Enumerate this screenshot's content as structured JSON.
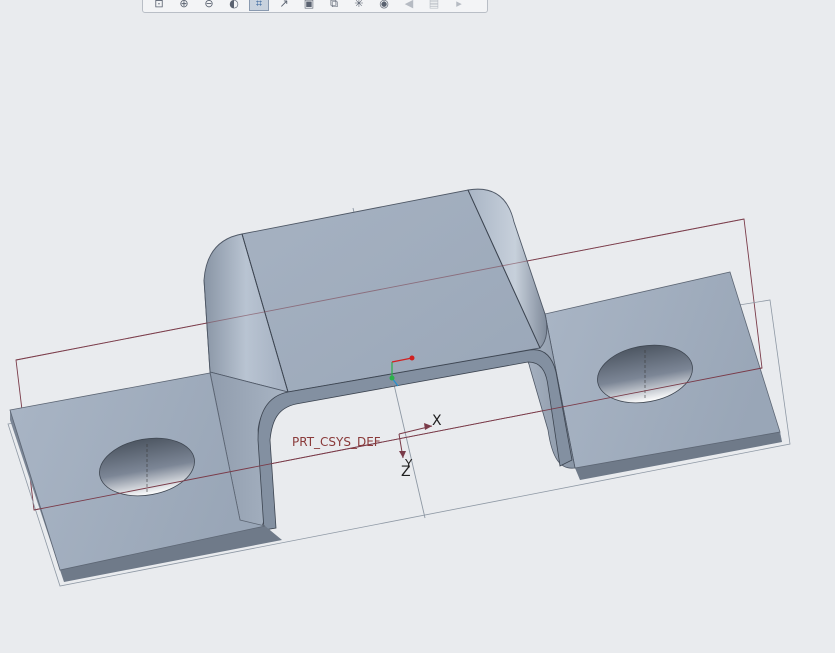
{
  "toolbar": {
    "buttons": [
      {
        "name": "refit",
        "glyph": "⊡",
        "active": false,
        "disabled": false
      },
      {
        "name": "zoom-in",
        "glyph": "⊕",
        "active": false,
        "disabled": false
      },
      {
        "name": "zoom-out",
        "glyph": "⊖",
        "active": false,
        "disabled": false
      },
      {
        "name": "display-style",
        "glyph": "◐",
        "active": false,
        "disabled": false
      },
      {
        "name": "plane-display",
        "glyph": "⌗",
        "active": true,
        "disabled": false
      },
      {
        "name": "axis-display",
        "glyph": "↗",
        "active": false,
        "disabled": false
      },
      {
        "name": "saved-views",
        "glyph": "▣",
        "active": false,
        "disabled": false
      },
      {
        "name": "view-manager",
        "glyph": "⧉",
        "active": false,
        "disabled": false
      },
      {
        "name": "spin-center",
        "glyph": "✳",
        "active": false,
        "disabled": false
      },
      {
        "name": "annotation-display",
        "glyph": "◉",
        "active": false,
        "disabled": false
      },
      {
        "name": "orient-mode",
        "glyph": "◀",
        "active": false,
        "disabled": true
      },
      {
        "name": "repaint",
        "glyph": "▤",
        "active": false,
        "disabled": true
      },
      {
        "name": "more",
        "glyph": "▸",
        "active": false,
        "disabled": true
      }
    ]
  },
  "model": {
    "csys_label": "PRT_CSYS_DEF",
    "axis_x": "X",
    "axis_y": "Y",
    "axis_z": "Z"
  },
  "colors": {
    "background": "#e9ebee",
    "part_top": "#a7b3c3",
    "part_side": "#6b7584",
    "datum_plane": "#7a3b49",
    "datum_axis": "#8e98a4"
  }
}
